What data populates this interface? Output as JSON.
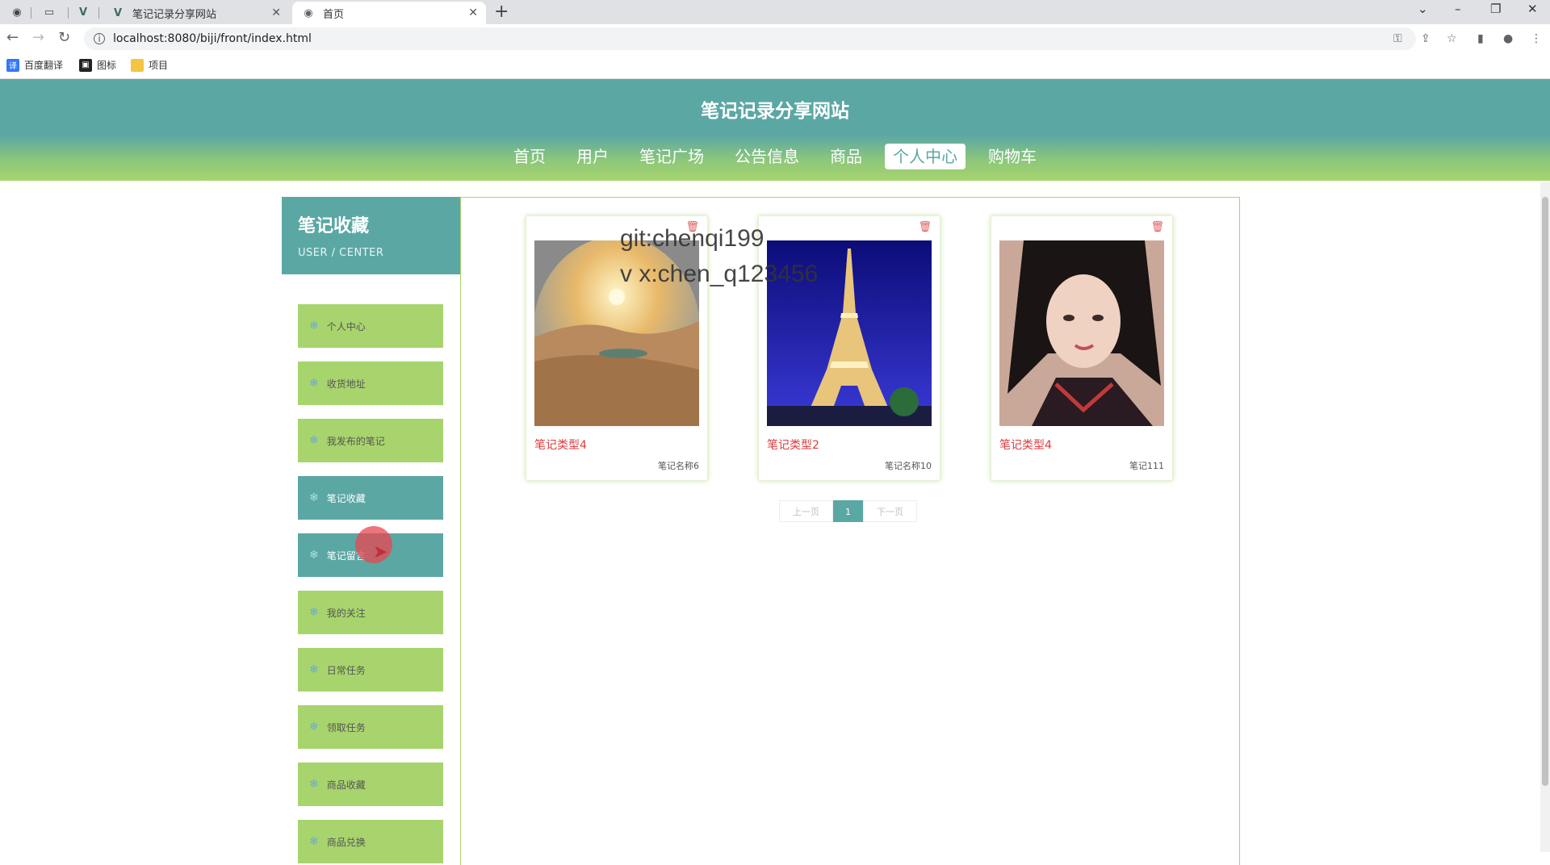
{
  "browser": {
    "tabs": [
      {
        "title": "笔记记录分享网站",
        "active": false
      },
      {
        "title": "首页",
        "active": true
      }
    ],
    "url": "localhost:8080/biji/front/index.html",
    "bookmarks": [
      "百度翻译",
      "图标",
      "项目"
    ]
  },
  "site": {
    "title": "笔记记录分享网站",
    "nav": [
      "首页",
      "用户",
      "笔记广场",
      "公告信息",
      "商品",
      "个人中心",
      "购物车"
    ],
    "nav_active": "个人中心"
  },
  "sidebar": {
    "title": "笔记收藏",
    "subtitle": "USER / CENTER",
    "items": [
      {
        "label": "个人中心"
      },
      {
        "label": "收货地址"
      },
      {
        "label": "我发布的笔记"
      },
      {
        "label": "笔记收藏"
      },
      {
        "label": "笔记留言"
      },
      {
        "label": "我的关注"
      },
      {
        "label": "日常任务"
      },
      {
        "label": "领取任务"
      },
      {
        "label": "商品收藏"
      },
      {
        "label": "商品兑换"
      }
    ]
  },
  "cards": [
    {
      "type": "笔记类型4",
      "name": "笔记名称6",
      "image": "desert-sunset"
    },
    {
      "type": "笔记类型2",
      "name": "笔记名称10",
      "image": "eiffel-tower"
    },
    {
      "type": "笔记类型4",
      "name": "笔记111",
      "image": "portrait"
    }
  ],
  "pagination": {
    "prev": "上一页",
    "current": "1",
    "next": "下一页"
  },
  "watermark": {
    "line1": "git:chenqi199",
    "line2": "v x:chen_q123456"
  },
  "colors": {
    "primary": "#5ba7a4",
    "accent": "#a8d46d",
    "card_title": "#e03a3a"
  }
}
